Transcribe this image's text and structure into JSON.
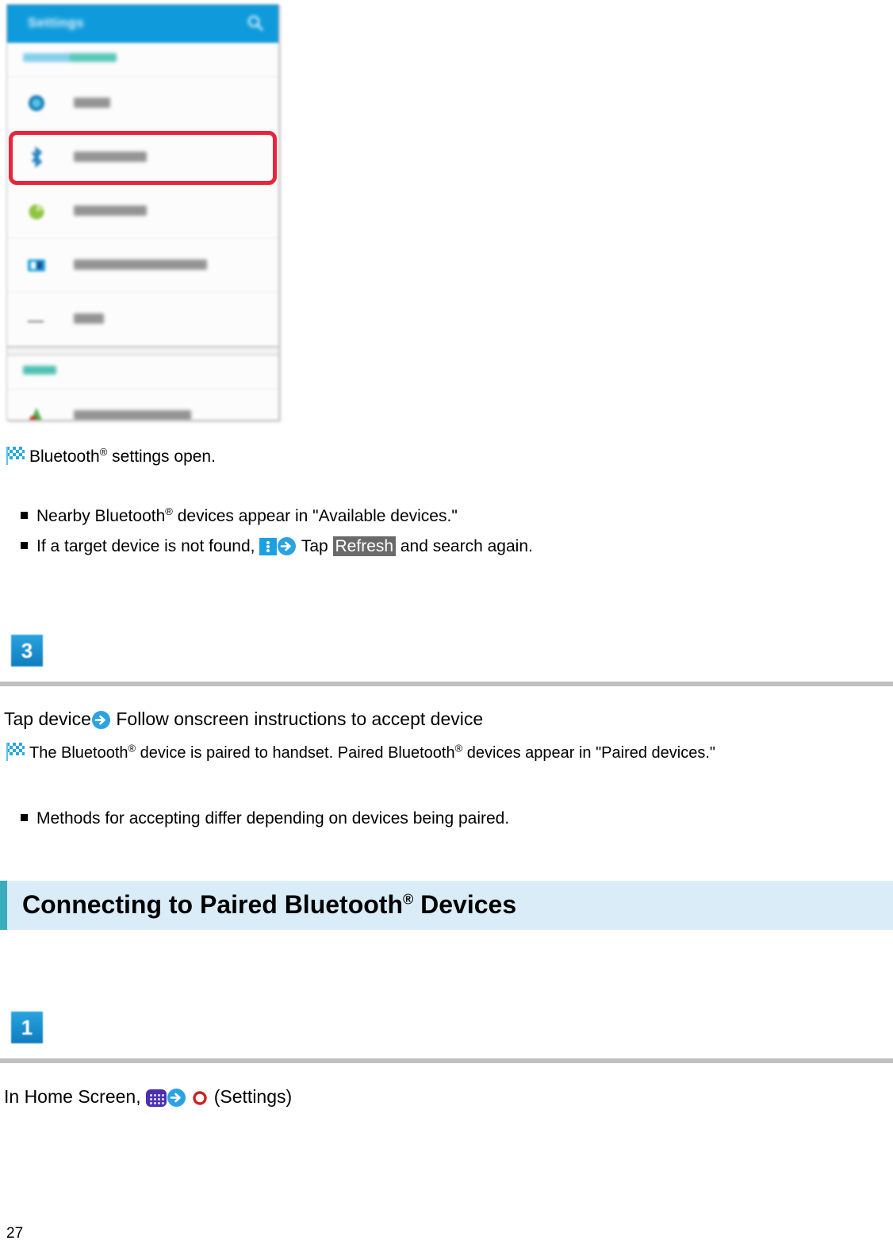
{
  "phone_screenshot": {
    "title": "Settings",
    "search_icon": "search-icon",
    "rows": [
      {
        "label": "Wi-Fi",
        "icon": "wifi-icon",
        "highlighted": false
      },
      {
        "label": "Bluetooth",
        "icon": "bluetooth-icon",
        "highlighted": true
      },
      {
        "label": "Data usage",
        "icon": "data-usage-icon",
        "highlighted": false
      },
      {
        "label": "Bypass™ Connectivity",
        "icon": "connectivity-icon",
        "highlighted": false
      },
      {
        "label": "More",
        "icon": "more-icon",
        "highlighted": false
      }
    ],
    "section_headers": [
      "Wireless & networks",
      "Device"
    ],
    "last_row": {
      "label": "Personalization",
      "icon": "personalize-icon"
    },
    "highlight_color": "#e8253b",
    "titlebar_color": "#0f9bdb"
  },
  "result_line": {
    "icon": "checkered-flag-icon",
    "text_before": "Bluetooth",
    "sup": "®",
    "text_after": " settings open."
  },
  "notes_1": [
    {
      "bullet": "■",
      "pre": "Nearby Bluetooth",
      "sup": "®",
      "post": " devices appear in \"Available devices.\""
    }
  ],
  "note_refresh": {
    "bullet": "■",
    "pre": "If a target device is not found, ",
    "menu_icon": "overflow-menu-icon",
    "arrow_icon": "arrow-right-icon",
    "tap_label": "Tap",
    "key_label": "Refresh",
    "post": " and search again."
  },
  "step3": {
    "badge": "3",
    "instruction_pre": "Tap device",
    "arrow_icon": "arrow-right-icon",
    "instruction_post": " Follow onscreen instructions to accept device",
    "result": {
      "icon": "checkered-flag-icon",
      "part1": "The Bluetooth",
      "sup1": "®",
      "part2": " device is paired to handset. Paired Bluetooth",
      "sup2": "®",
      "part3": " devices appear in \"Paired devices.\""
    },
    "note": {
      "bullet": "■",
      "text": "Methods for accepting differ depending on devices being paired."
    }
  },
  "section_heading": {
    "pre": "Connecting to Paired Bluetooth",
    "sup": "®",
    "post": " Devices",
    "background": "#d9ecf8",
    "bar_color": "#3aacbe"
  },
  "step1": {
    "badge": "1",
    "instruction_pre": "In Home Screen, ",
    "drawer_icon": "app-drawer-icon",
    "arrow_icon": "arrow-right-icon",
    "gear_icon": "settings-gear-icon",
    "instruction_post": " (Settings)"
  },
  "footer": {
    "page_number": "27"
  }
}
